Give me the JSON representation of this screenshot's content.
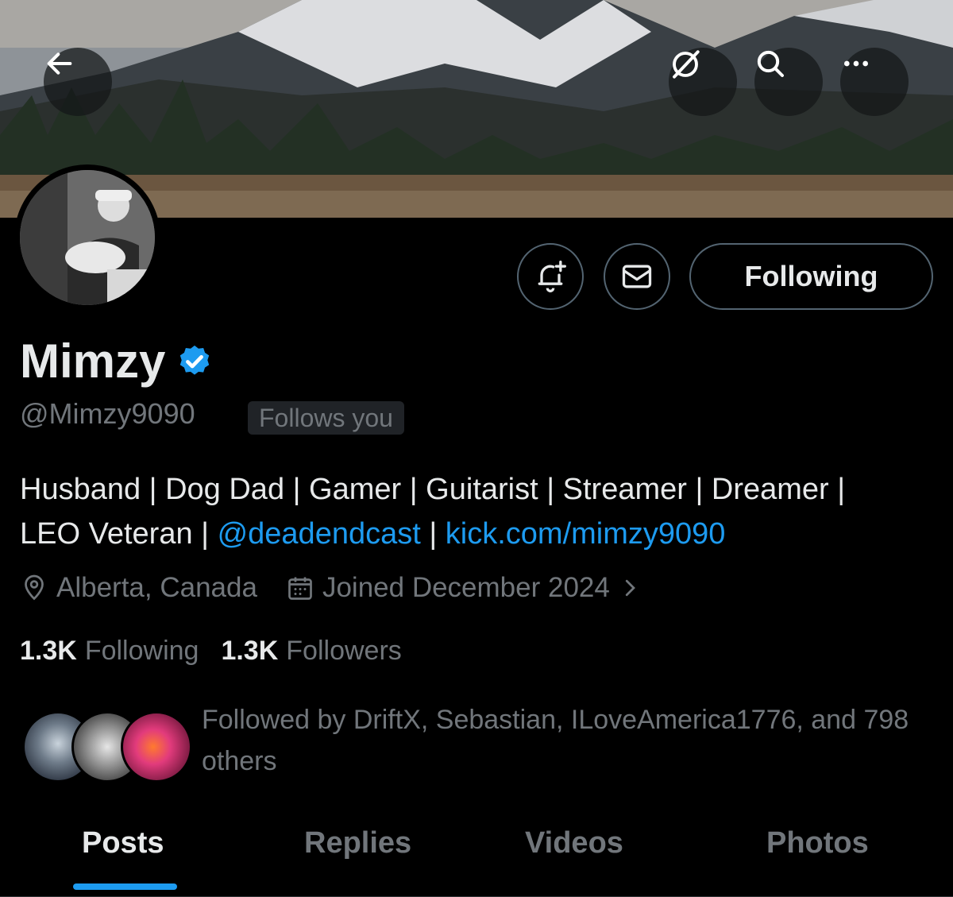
{
  "header": {
    "back_icon": "arrow-left-icon",
    "grok_icon": "grok-icon",
    "search_icon": "search-icon",
    "more_icon": "more-horizontal-icon"
  },
  "actions": {
    "notify_icon": "bell-plus-icon",
    "message_icon": "envelope-icon",
    "following_label": "Following"
  },
  "profile": {
    "name": "Mimzy",
    "verified_icon": "verified-badge-icon",
    "handle": "@Mimzy9090",
    "follows_you": "Follows you",
    "bio_line1": "Husband | Dog Dad | Gamer | Guitarist | Streamer | Dreamer |",
    "bio_line2_prefix": "LEO Veteran | ",
    "bio_mention": "@deadendcast",
    "bio_sep": " | ",
    "bio_link": "kick.com/mimzy9090",
    "location": "Alberta, Canada",
    "joined": "Joined December 2024"
  },
  "stats": {
    "following_count": "1.3K",
    "following_label": "Following",
    "followers_count": "1.3K",
    "followers_label": "Followers"
  },
  "followed_by": {
    "text": "Followed by DriftX, Sebastian, ILoveAmerica1776, and 798 others"
  },
  "tabs": [
    {
      "label": "Posts",
      "active": true
    },
    {
      "label": "Replies",
      "active": false
    },
    {
      "label": "Videos",
      "active": false
    },
    {
      "label": "Photos",
      "active": false
    }
  ],
  "colors": {
    "accent": "#1d9bf0",
    "background": "#000000",
    "text": "#e7e9ea",
    "muted": "#71767b"
  }
}
